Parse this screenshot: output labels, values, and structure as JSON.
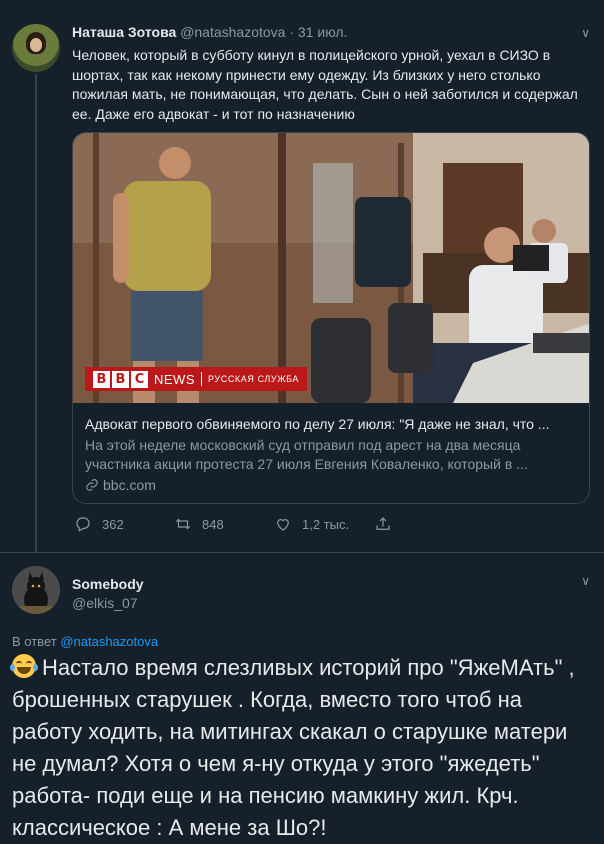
{
  "tweet": {
    "author_name": "Наташа Зотова",
    "author_handle": "@natashazotova",
    "date": "· 31 июл.",
    "text": "Человек, который в субботу кинул в полицейского урной, уехал в СИЗО в шортах, так как некому принести ему одежду. Из близких у него столько пожилая мать, не понимающая, что делать. Сын о ней заботился и содержал ее. Даже его адвокат - и тот по назначению",
    "card": {
      "logo": [
        "B",
        "B",
        "C"
      ],
      "news": "NEWS",
      "service": "РУССКАЯ СЛУЖБА",
      "title": "Адвокат первого обвиняемого по делу 27 июля: \"Я даже не знал, что ...",
      "description": "На этой неделе московский суд отправил под арест на два месяца участника акции протеста 27 июля Евгения Коваленко, который в ...",
      "link": "bbc.com"
    },
    "actions": {
      "replies": "362",
      "retweets": "848",
      "likes": "1,2 тыс."
    }
  },
  "reply": {
    "author_name": "Somebody",
    "author_handle": "@elkis_07",
    "in_reply_prefix": "В ответ",
    "in_reply_handle": "@natashazotova",
    "text": "Настало время слезливых историй про \"ЯжеМАть\" , брошенных  старушек . Когда, вместо того чтоб на работу ходить, на митингах скакал о старушке матери не думал? Хотя о чем я-ну откуда у этого \"яжедеть\" работа- поди еще и на пенсию мамкину жил. Крч. классическое : А мене за Шо?!"
  },
  "colors": {
    "background": "#15202b",
    "text": "#e7e9ea",
    "secondary": "#8b98a5",
    "link": "#1d9bf0",
    "bbc_red": "#bb1919"
  },
  "icons": [
    "chevron-down-icon",
    "reply-icon",
    "retweet-icon",
    "like-icon",
    "share-icon",
    "link-icon",
    "tears-of-joy-emoji"
  ]
}
